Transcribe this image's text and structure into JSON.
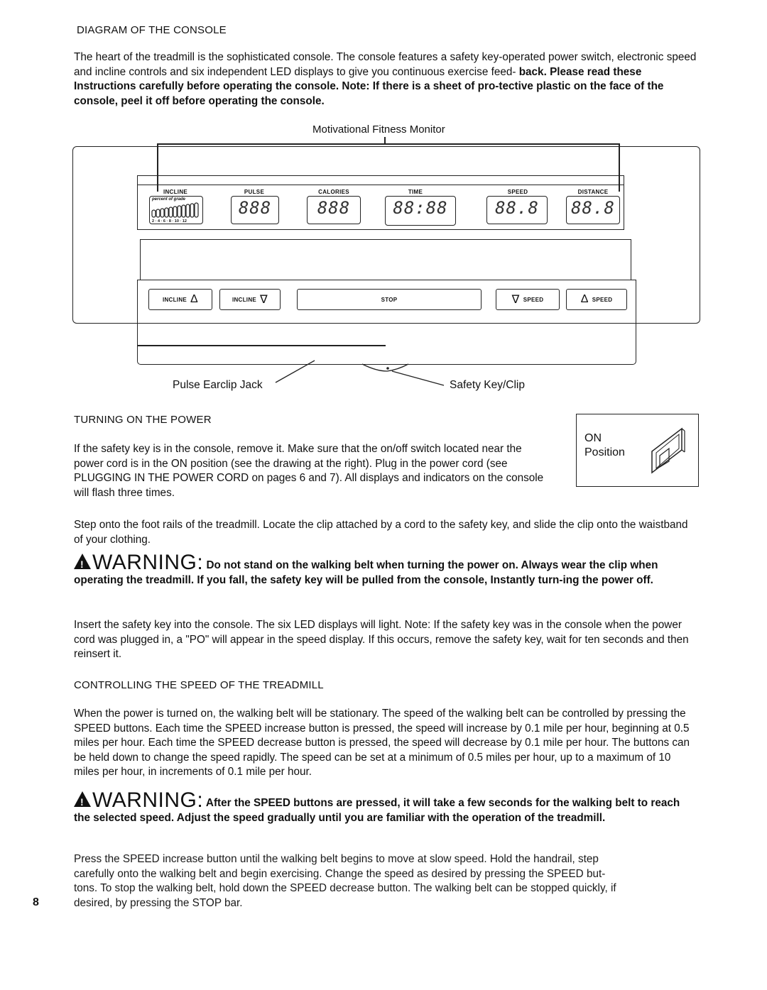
{
  "page_number": "8",
  "sections": {
    "console": {
      "heading": "DIAGRAM OF THE CONSOLE",
      "intro_plain": "The heart of the treadmill is the sophisticated console. The console features a safety key-operated power switch, electronic speed and incline controls and six independent LED displays to give you continuous exercise feed-",
      "intro_bold": "back. Please read these Instructions carefully before operating the console. Note: If there is a sheet of pro-tective plastic on the face of the console, peel it off before operating the console."
    },
    "diagram": {
      "monitor_label": "Motivational Fitness Monitor",
      "displays": [
        {
          "label": "INCLINE",
          "value": "",
          "sublabel": "percent of grade",
          "scale": "2 · 4 · 6 · 8 · 10 · 12"
        },
        {
          "label": "PULSE",
          "value": "888"
        },
        {
          "label": "CALORIES",
          "value": "888"
        },
        {
          "label": "TIME",
          "value": "88:88"
        },
        {
          "label": "SPEED",
          "value": "88.8"
        },
        {
          "label": "DISTANCE",
          "value": "88.8"
        }
      ],
      "buttons": [
        {
          "label": "INCLINE",
          "icon": "triangle-up-icon",
          "glyph": "Δ"
        },
        {
          "label": "INCLINE",
          "icon": "triangle-down-icon",
          "glyph": "∇"
        },
        {
          "label": "STOP",
          "icon": "",
          "glyph": ""
        },
        {
          "label": "SPEED",
          "icon": "triangle-down-icon",
          "glyph": "∇"
        },
        {
          "label": "SPEED",
          "icon": "triangle-up-icon",
          "glyph": "Δ"
        }
      ],
      "callout_left": "Pulse Earclip Jack",
      "callout_right": "Safety Key/Clip"
    },
    "power": {
      "heading": "TURNING ON THE POWER",
      "paragraph": "If the safety key is in the console, remove it. Make sure that the on/off switch located near the power cord is in the ON position (see the drawing at the right). Plug in the power cord (see PLUGGING IN THE POWER CORD on pages 6 and 7). All displays and indicators on the console will flash three times.",
      "switch_label_1": "ON",
      "switch_label_2": "Position",
      "step_paragraph": "Step onto the foot rails of the treadmill. Locate the clip attached by a cord to the safety key, and slide the clip onto the waistband of your clothing.",
      "warning_word": "WARNING:",
      "warning_text": "Do not stand on the walking belt when turning the power on. Always wear the clip when operating the treadmill. If you fall, the safety key will be pulled from the console, Instantly turn-ing the power off.",
      "insert_paragraph": "Insert the safety key into the console. The six LED displays will light. Note: If the safety key was in the console when the power cord was plugged in, a \"PO\" will appear in the speed display. If this occurs, remove the safety key, wait for ten seconds and then reinsert it."
    },
    "speed": {
      "heading": "CONTROLLING THE SPEED OF THE TREADMILL",
      "paragraph": "When the power is turned on, the walking belt will be stationary. The speed of the walking belt can be controlled by pressing the SPEED buttons. Each time the SPEED increase button is pressed, the speed will increase by 0.1 mile per hour, beginning at 0.5 miles per hour. Each time the SPEED decrease button is pressed, the speed will decrease by 0.1 mile per hour. The buttons can be held down to change the speed rapidly. The speed can be set at a minimum of 0.5 miles per hour, up to a maximum of 10 miles per hour, in increments of 0.1 mile per hour.",
      "warning_word": "WARNING:",
      "warning_text": "After the SPEED buttons are pressed, it will take a few seconds for the walking belt to reach the selected speed. Adjust the speed gradually until you are familiar with the operation of the treadmill.",
      "final_1": "Press the SPEED increase button until the walking belt begins to move at slow speed. Hold the handrail, step",
      "final_2": "carefully onto the walking belt and begin exercising. Change the speed as desired by pressing the SPEED but-",
      "final_3": "tons. To stop the walking belt, hold down the SPEED decrease button. The walking belt can be stopped quickly, if",
      "final_4": "desired, by pressing the STOP bar."
    }
  }
}
